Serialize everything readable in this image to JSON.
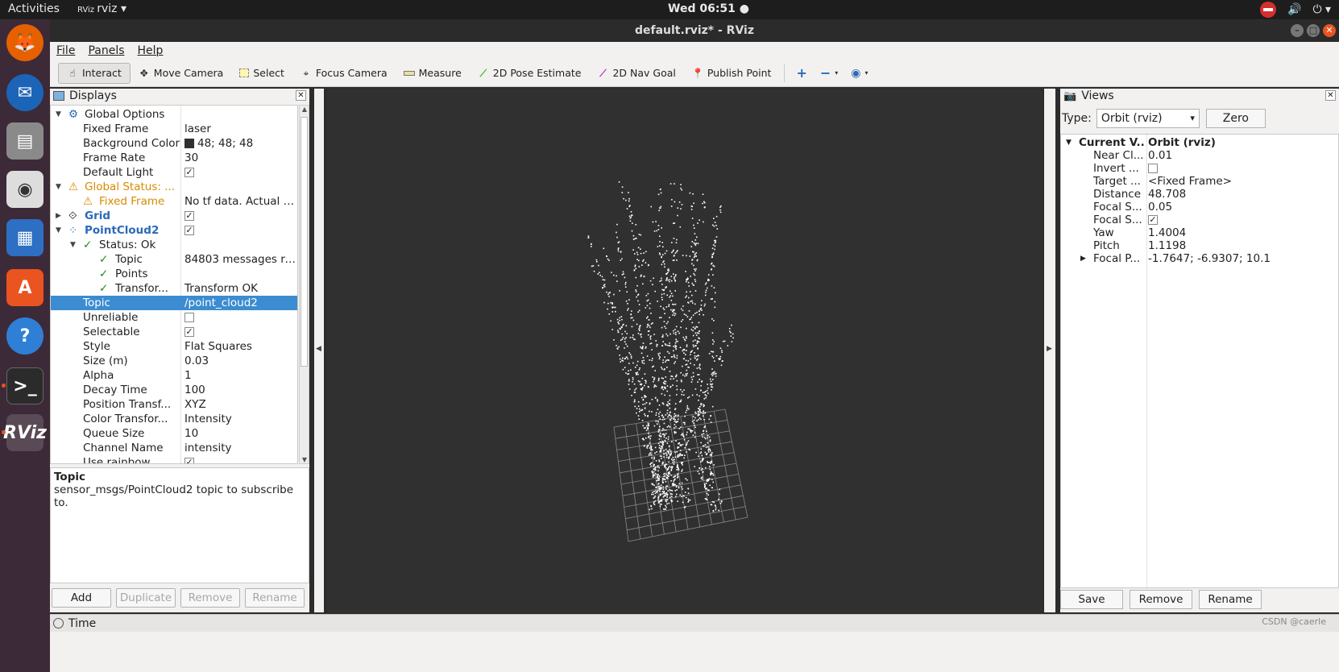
{
  "topbar": {
    "activities": "Activities",
    "app_name": "rviz",
    "clock": "Wed 06:51 ●"
  },
  "window": {
    "title": "default.rviz* - RViz"
  },
  "menu": [
    "File",
    "Panels",
    "Help"
  ],
  "toolbar": {
    "interact": "Interact",
    "move_camera": "Move Camera",
    "select": "Select",
    "focus_camera": "Focus Camera",
    "measure": "Measure",
    "pose_estimate": "2D Pose Estimate",
    "nav_goal": "2D Nav Goal",
    "publish_point": "Publish Point"
  },
  "displays": {
    "title": "Displays",
    "rows": {
      "global_options": "Global Options",
      "fixed_frame_k": "Fixed Frame",
      "fixed_frame_v": "laser",
      "bg_color_k": "Background Color",
      "bg_color_v": "48; 48; 48",
      "frame_rate_k": "Frame Rate",
      "frame_rate_v": "30",
      "default_light_k": "Default Light",
      "global_status_k": "Global Status: ...",
      "status_fixed_frame_k": "Fixed Frame",
      "status_fixed_frame_v": "No tf data.  Actual e...",
      "grid_k": "Grid",
      "pc2_k": "PointCloud2",
      "status_ok_k": "Status: Ok",
      "topic_status_k": "Topic",
      "topic_status_v": "84803 messages re...",
      "points_k": "Points",
      "transform_k": "Transfor...",
      "transform_v": "Transform OK",
      "topic_k": "Topic",
      "topic_v": "/point_cloud2",
      "unreliable_k": "Unreliable",
      "selectable_k": "Selectable",
      "style_k": "Style",
      "style_v": "Flat Squares",
      "size_k": "Size (m)",
      "size_v": "0.03",
      "alpha_k": "Alpha",
      "alpha_v": "1",
      "decay_k": "Decay Time",
      "decay_v": "100",
      "postf_k": "Position Transf...",
      "postf_v": "XYZ",
      "colortf_k": "Color Transfor...",
      "colortf_v": "Intensity",
      "queue_k": "Queue Size",
      "queue_v": "10",
      "channel_k": "Channel Name",
      "channel_v": "intensity",
      "rainbow_k": "Use rainbow"
    },
    "description": {
      "title": "Topic",
      "body": "sensor_msgs/PointCloud2 topic to subscribe to."
    },
    "buttons": {
      "add": "Add",
      "duplicate": "Duplicate",
      "remove": "Remove",
      "rename": "Rename"
    }
  },
  "views": {
    "title": "Views",
    "type_label": "Type:",
    "type_value": "Orbit (rviz)",
    "zero": "Zero",
    "rows": {
      "current_k": "Current V...",
      "current_v": "Orbit (rviz)",
      "near_k": "Near Cl...",
      "near_v": "0.01",
      "invert_k": "Invert ...",
      "target_k": "Target ...",
      "target_v": "<Fixed Frame>",
      "distance_k": "Distance",
      "distance_v": "48.708",
      "focal_s1_k": "Focal S...",
      "focal_s1_v": "0.05",
      "focal_s2_k": "Focal S...",
      "yaw_k": "Yaw",
      "yaw_v": "1.4004",
      "pitch_k": "Pitch",
      "pitch_v": "1.1198",
      "focal_p_k": "Focal P...",
      "focal_p_v": "-1.7647; -6.9307; 10.1"
    },
    "buttons": {
      "save": "Save",
      "remove": "Remove",
      "rename": "Rename"
    }
  },
  "time_panel": {
    "title": "Time"
  },
  "watermark": "CSDN @caerle",
  "colors": {
    "viewport_bg": "#303030",
    "selection": "#3b8cd0",
    "dock": "#3d2a38"
  }
}
